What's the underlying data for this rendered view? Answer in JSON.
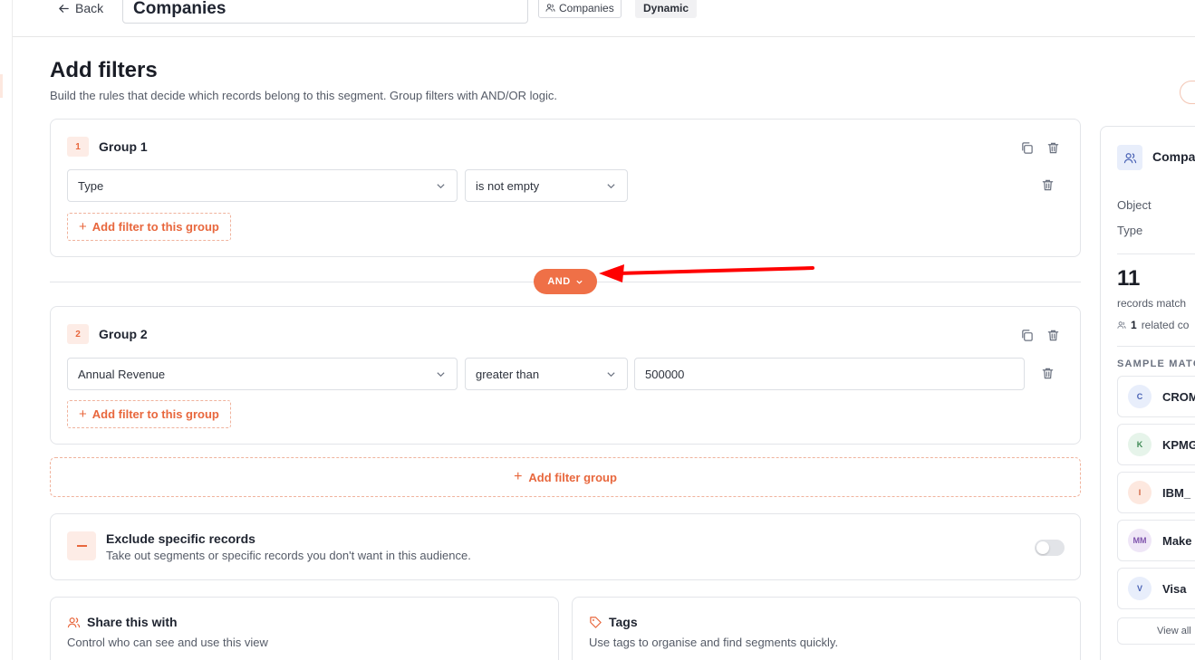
{
  "topbar": {
    "back_label": "Back",
    "segment_name": "Companies",
    "object_chip": "Companies",
    "type_chip": "Dynamic"
  },
  "header": {
    "title": "Add filters",
    "subtitle": "Build the rules that decide which records belong to this segment. Group filters with AND/OR logic."
  },
  "groups": [
    {
      "number": "1",
      "title": "Group 1",
      "filters": [
        {
          "field": "Type",
          "operator": "is not empty",
          "value": ""
        }
      ],
      "add_filter_label": "Add filter to this group"
    },
    {
      "number": "2",
      "title": "Group 2",
      "filters": [
        {
          "field": "Annual Revenue",
          "operator": "greater than",
          "value": "500000"
        }
      ],
      "add_filter_label": "Add filter to this group"
    }
  ],
  "connector": {
    "label": "AND"
  },
  "add_group_label": "Add filter group",
  "exclude": {
    "title": "Exclude specific records",
    "subtitle": "Take out segments or specific records you don't want in this audience.",
    "enabled": false
  },
  "share": {
    "title": "Share this with",
    "subtitle": "Control who can see and use this view"
  },
  "tags": {
    "title": "Tags",
    "subtitle": "Use tags to organise and find segments quickly."
  },
  "summary": {
    "title": "Compa",
    "object_label": "Object",
    "type_label": "Type",
    "count": "11",
    "match_label": "records match",
    "related_count": "1",
    "related_label": "related co",
    "section_label": "SAMPLE MATC",
    "samples": [
      {
        "initials": "C",
        "name": "CROM",
        "bg": "#e8eefb",
        "fg": "#4a63b5"
      },
      {
        "initials": "K",
        "name": "KPMG",
        "bg": "#e6f4ea",
        "fg": "#3f8a55"
      },
      {
        "initials": "I",
        "name": "IBM_",
        "bg": "#fde8df",
        "fg": "#d2613d"
      },
      {
        "initials": "MM",
        "name": "Make",
        "bg": "#efe6f7",
        "fg": "#8055ad"
      },
      {
        "initials": "V",
        "name": "Visa",
        "bg": "#e8eefb",
        "fg": "#4a63b5"
      }
    ],
    "view_all_label": "View all"
  },
  "colors": {
    "accent": "#ef7047",
    "annotation_arrow": "#ff0000"
  }
}
